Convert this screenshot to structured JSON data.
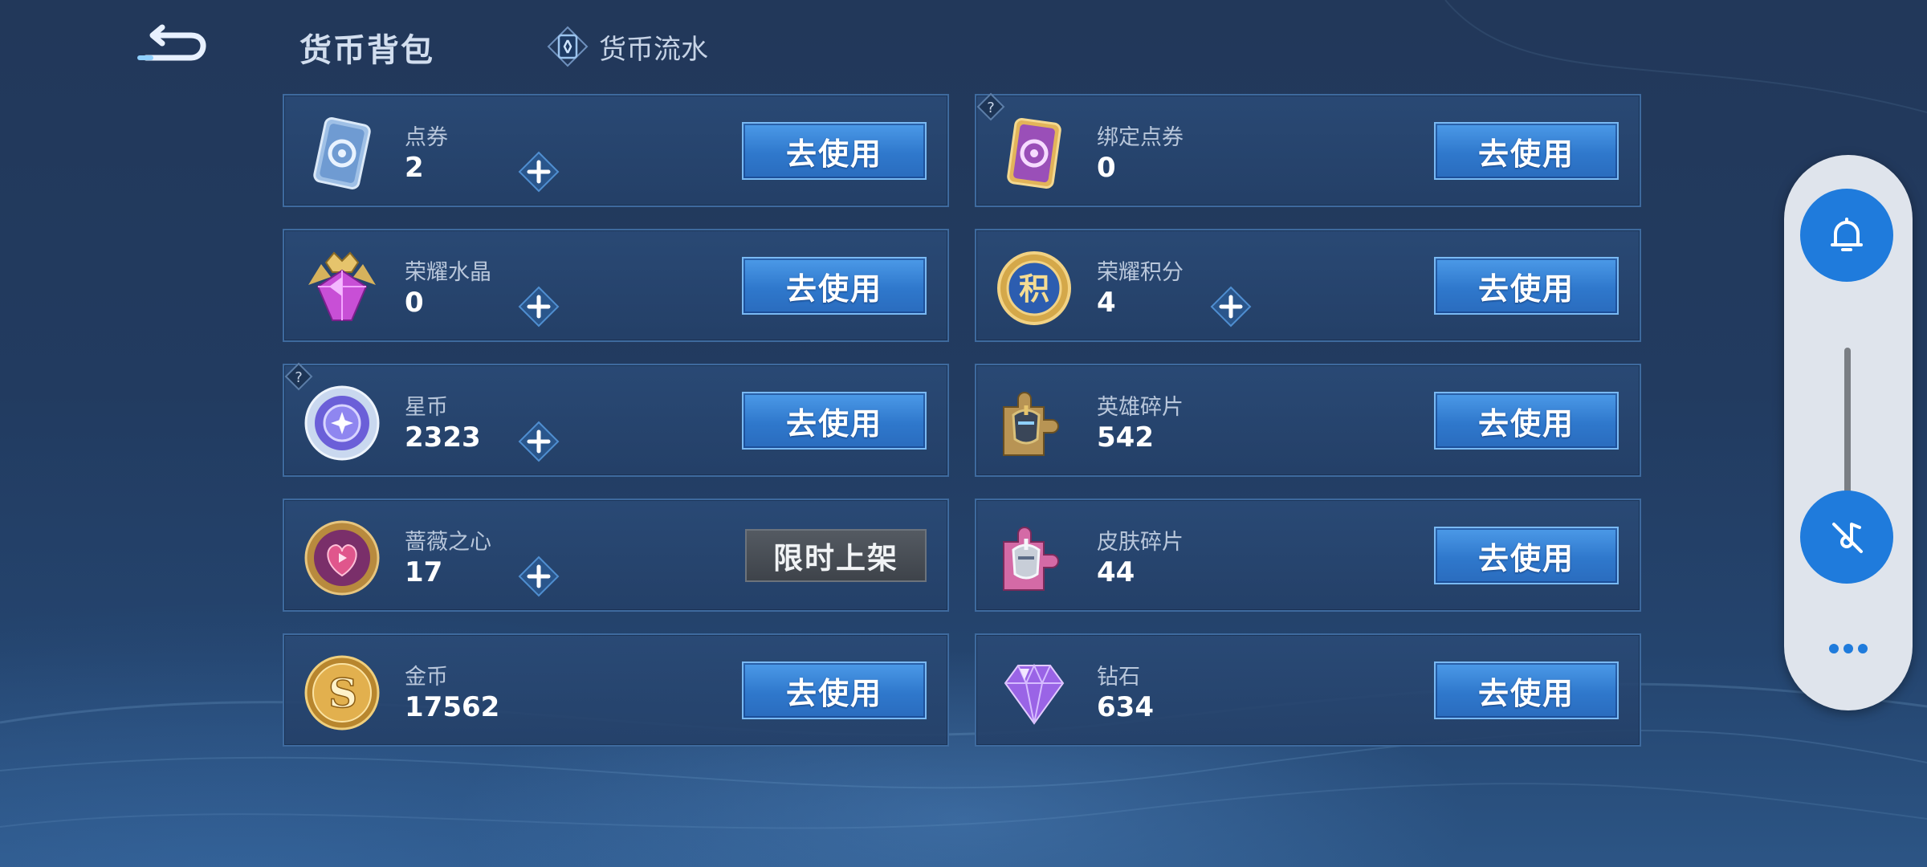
{
  "header": {
    "title": "货币背包",
    "flow_link": "货币流水"
  },
  "currencies": [
    {
      "name": "点券",
      "value": "2",
      "action": "去使用",
      "icon": "coupon-card-icon"
    },
    {
      "name": "绑定点券",
      "value": "0",
      "action": "去使用",
      "icon": "bound-coupon-card-icon"
    },
    {
      "name": "荣耀水晶",
      "value": "0",
      "action": "去使用",
      "icon": "glory-crystal-icon"
    },
    {
      "name": "荣耀积分",
      "value": "4",
      "action": "去使用",
      "icon": "glory-points-icon"
    },
    {
      "name": "星币",
      "value": "2323",
      "action": "去使用",
      "icon": "star-coin-icon"
    },
    {
      "name": "英雄碎片",
      "value": "542",
      "action": "去使用",
      "icon": "hero-fragment-icon"
    },
    {
      "name": "蔷薇之心",
      "value": "17",
      "action": "限时上架",
      "icon": "rose-heart-icon"
    },
    {
      "name": "皮肤碎片",
      "value": "44",
      "action": "去使用",
      "icon": "skin-fragment-icon"
    },
    {
      "name": "金币",
      "value": "17562",
      "action": "去使用",
      "icon": "gold-coin-icon"
    },
    {
      "name": "钻石",
      "value": "634",
      "action": "去使用",
      "icon": "diamond-icon"
    }
  ],
  "side_panel": {
    "icons": [
      "bell-icon",
      "mute-icon",
      "more-icon"
    ]
  },
  "colors": {
    "background": "#223b60",
    "card_border": "#3e6a9e",
    "button_blue": "#2f78cc",
    "side_accent": "#1f7bdc"
  }
}
